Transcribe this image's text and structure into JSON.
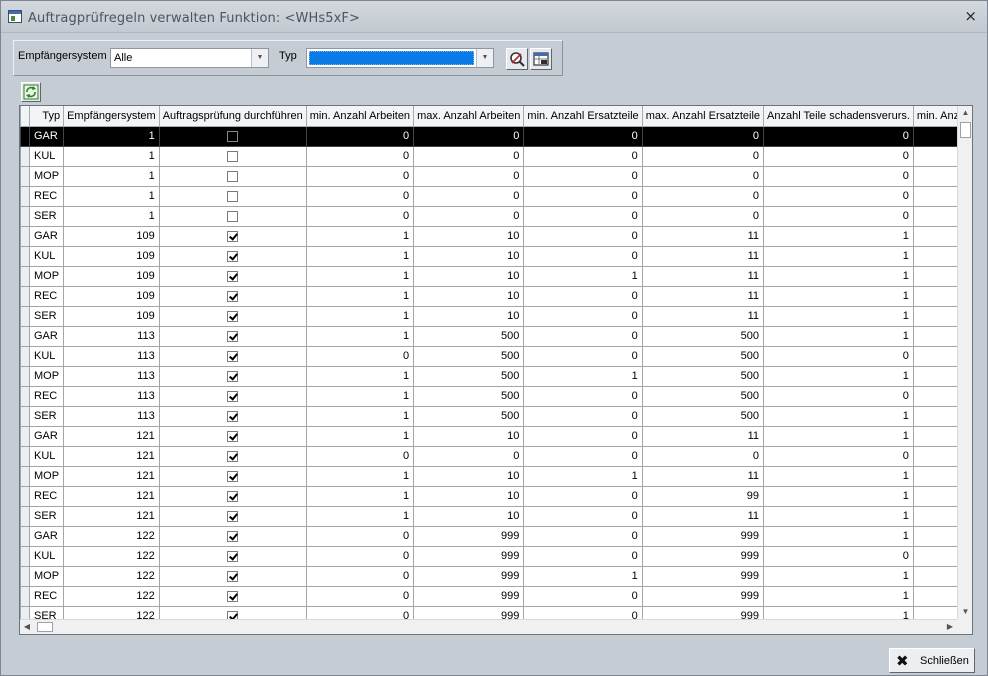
{
  "window": {
    "title": "Auftragprüfregeln verwalten Funktion: <WHs5xF>",
    "close_glyph": "×"
  },
  "filter": {
    "empfaengersystem_label": "Empfängersystem",
    "empfaengersystem_value": "Alle",
    "typ_label": "Typ",
    "typ_value": "",
    "search_icon": "search-icon",
    "grid_icon": "grid-settings-icon"
  },
  "toolbar": {
    "refresh_icon": "refresh-icon"
  },
  "grid": {
    "columns": [
      "",
      "Typ",
      "Empfängersystem",
      "Auftragsprüfung durchführen",
      "min. Anzahl Arbeiten",
      "max. Anzahl Arbeiten",
      "min. Anzahl Ersatzteile",
      "max. Anzahl Ersatzteile",
      "Anzahl Teile schadensverurs.",
      "min. Anzahl"
    ],
    "rows": [
      [
        "GAR",
        "1",
        false,
        "0",
        "0",
        "0",
        "0",
        "0",
        ""
      ],
      [
        "KUL",
        "1",
        false,
        "0",
        "0",
        "0",
        "0",
        "0",
        ""
      ],
      [
        "MOP",
        "1",
        false,
        "0",
        "0",
        "0",
        "0",
        "0",
        ""
      ],
      [
        "REC",
        "1",
        false,
        "0",
        "0",
        "0",
        "0",
        "0",
        ""
      ],
      [
        "SER",
        "1",
        false,
        "0",
        "0",
        "0",
        "0",
        "0",
        ""
      ],
      [
        "GAR",
        "109",
        true,
        "1",
        "10",
        "0",
        "11",
        "1",
        ""
      ],
      [
        "KUL",
        "109",
        true,
        "1",
        "10",
        "0",
        "11",
        "1",
        ""
      ],
      [
        "MOP",
        "109",
        true,
        "1",
        "10",
        "1",
        "11",
        "1",
        ""
      ],
      [
        "REC",
        "109",
        true,
        "1",
        "10",
        "0",
        "11",
        "1",
        ""
      ],
      [
        "SER",
        "109",
        true,
        "1",
        "10",
        "0",
        "11",
        "1",
        ""
      ],
      [
        "GAR",
        "113",
        true,
        "1",
        "500",
        "0",
        "500",
        "1",
        ""
      ],
      [
        "KUL",
        "113",
        true,
        "0",
        "500",
        "0",
        "500",
        "0",
        ""
      ],
      [
        "MOP",
        "113",
        true,
        "1",
        "500",
        "1",
        "500",
        "1",
        ""
      ],
      [
        "REC",
        "113",
        true,
        "1",
        "500",
        "0",
        "500",
        "0",
        ""
      ],
      [
        "SER",
        "113",
        true,
        "1",
        "500",
        "0",
        "500",
        "1",
        ""
      ],
      [
        "GAR",
        "121",
        true,
        "1",
        "10",
        "0",
        "11",
        "1",
        ""
      ],
      [
        "KUL",
        "121",
        true,
        "0",
        "0",
        "0",
        "0",
        "0",
        ""
      ],
      [
        "MOP",
        "121",
        true,
        "1",
        "10",
        "1",
        "11",
        "1",
        ""
      ],
      [
        "REC",
        "121",
        true,
        "1",
        "10",
        "0",
        "99",
        "1",
        ""
      ],
      [
        "SER",
        "121",
        true,
        "1",
        "10",
        "0",
        "11",
        "1",
        ""
      ],
      [
        "GAR",
        "122",
        true,
        "0",
        "999",
        "0",
        "999",
        "1",
        ""
      ],
      [
        "KUL",
        "122",
        true,
        "0",
        "999",
        "0",
        "999",
        "0",
        ""
      ],
      [
        "MOP",
        "122",
        true,
        "0",
        "999",
        "1",
        "999",
        "1",
        ""
      ],
      [
        "REC",
        "122",
        true,
        "0",
        "999",
        "0",
        "999",
        "1",
        ""
      ],
      [
        "SER",
        "122",
        true,
        "0",
        "999",
        "0",
        "999",
        "1",
        ""
      ]
    ],
    "active_row": 0
  },
  "footer": {
    "close_label": "Schließen",
    "close_icon": "close-icon"
  }
}
